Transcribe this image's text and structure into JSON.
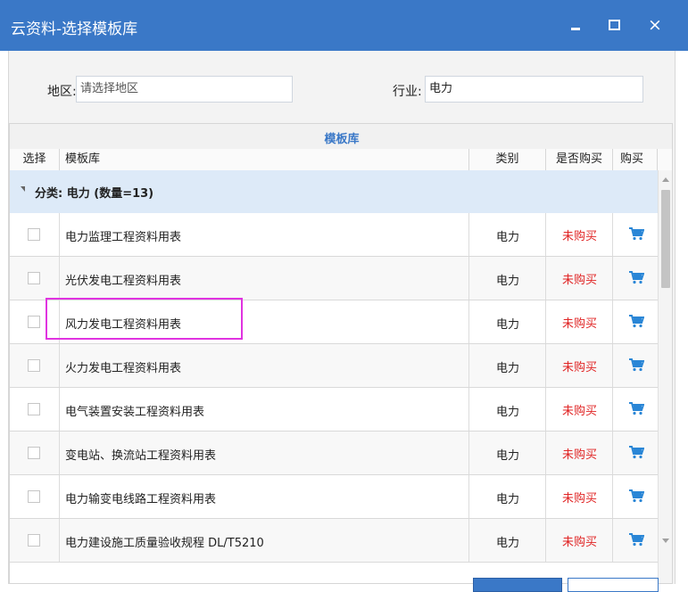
{
  "window": {
    "title": "云资料-选择模板库",
    "min_label": "",
    "max_label": "",
    "close_label": "×"
  },
  "filters": {
    "region_label": "地区:",
    "region_placeholder": "请选择地区",
    "industry_label": "行业:",
    "industry_value": "电力"
  },
  "grid": {
    "group_header": "模板库",
    "columns": [
      "选择",
      "模板库",
      "类别",
      "是否购买",
      "购买"
    ],
    "category": "分类: 电力 (数量=13)",
    "rows": [
      {
        "name": "电力监理工程资料用表",
        "type": "电力",
        "status": "未购买"
      },
      {
        "name": "光伏发电工程资料用表",
        "type": "电力",
        "status": "未购买"
      },
      {
        "name": "风力发电工程资料用表",
        "type": "电力",
        "status": "未购买"
      },
      {
        "name": "火力发电工程资料用表",
        "type": "电力",
        "status": "未购买"
      },
      {
        "name": "电气装置安装工程资料用表",
        "type": "电力",
        "status": "未购买"
      },
      {
        "name": "变电站、换流站工程资料用表",
        "type": "电力",
        "status": "未购买"
      },
      {
        "name": "电力输变电线路工程资料用表",
        "type": "电力",
        "status": "未购买"
      },
      {
        "name": "电力建设施工质量验收规程 DL/T5210",
        "type": "电力",
        "status": "未购买"
      }
    ]
  },
  "colors": {
    "accent": "#3a78c7",
    "status_red": "#e02424",
    "highlight": "#e033e0"
  },
  "icons": {
    "cart": "shopping-cart-icon",
    "collapse": "triangle-down-icon"
  }
}
